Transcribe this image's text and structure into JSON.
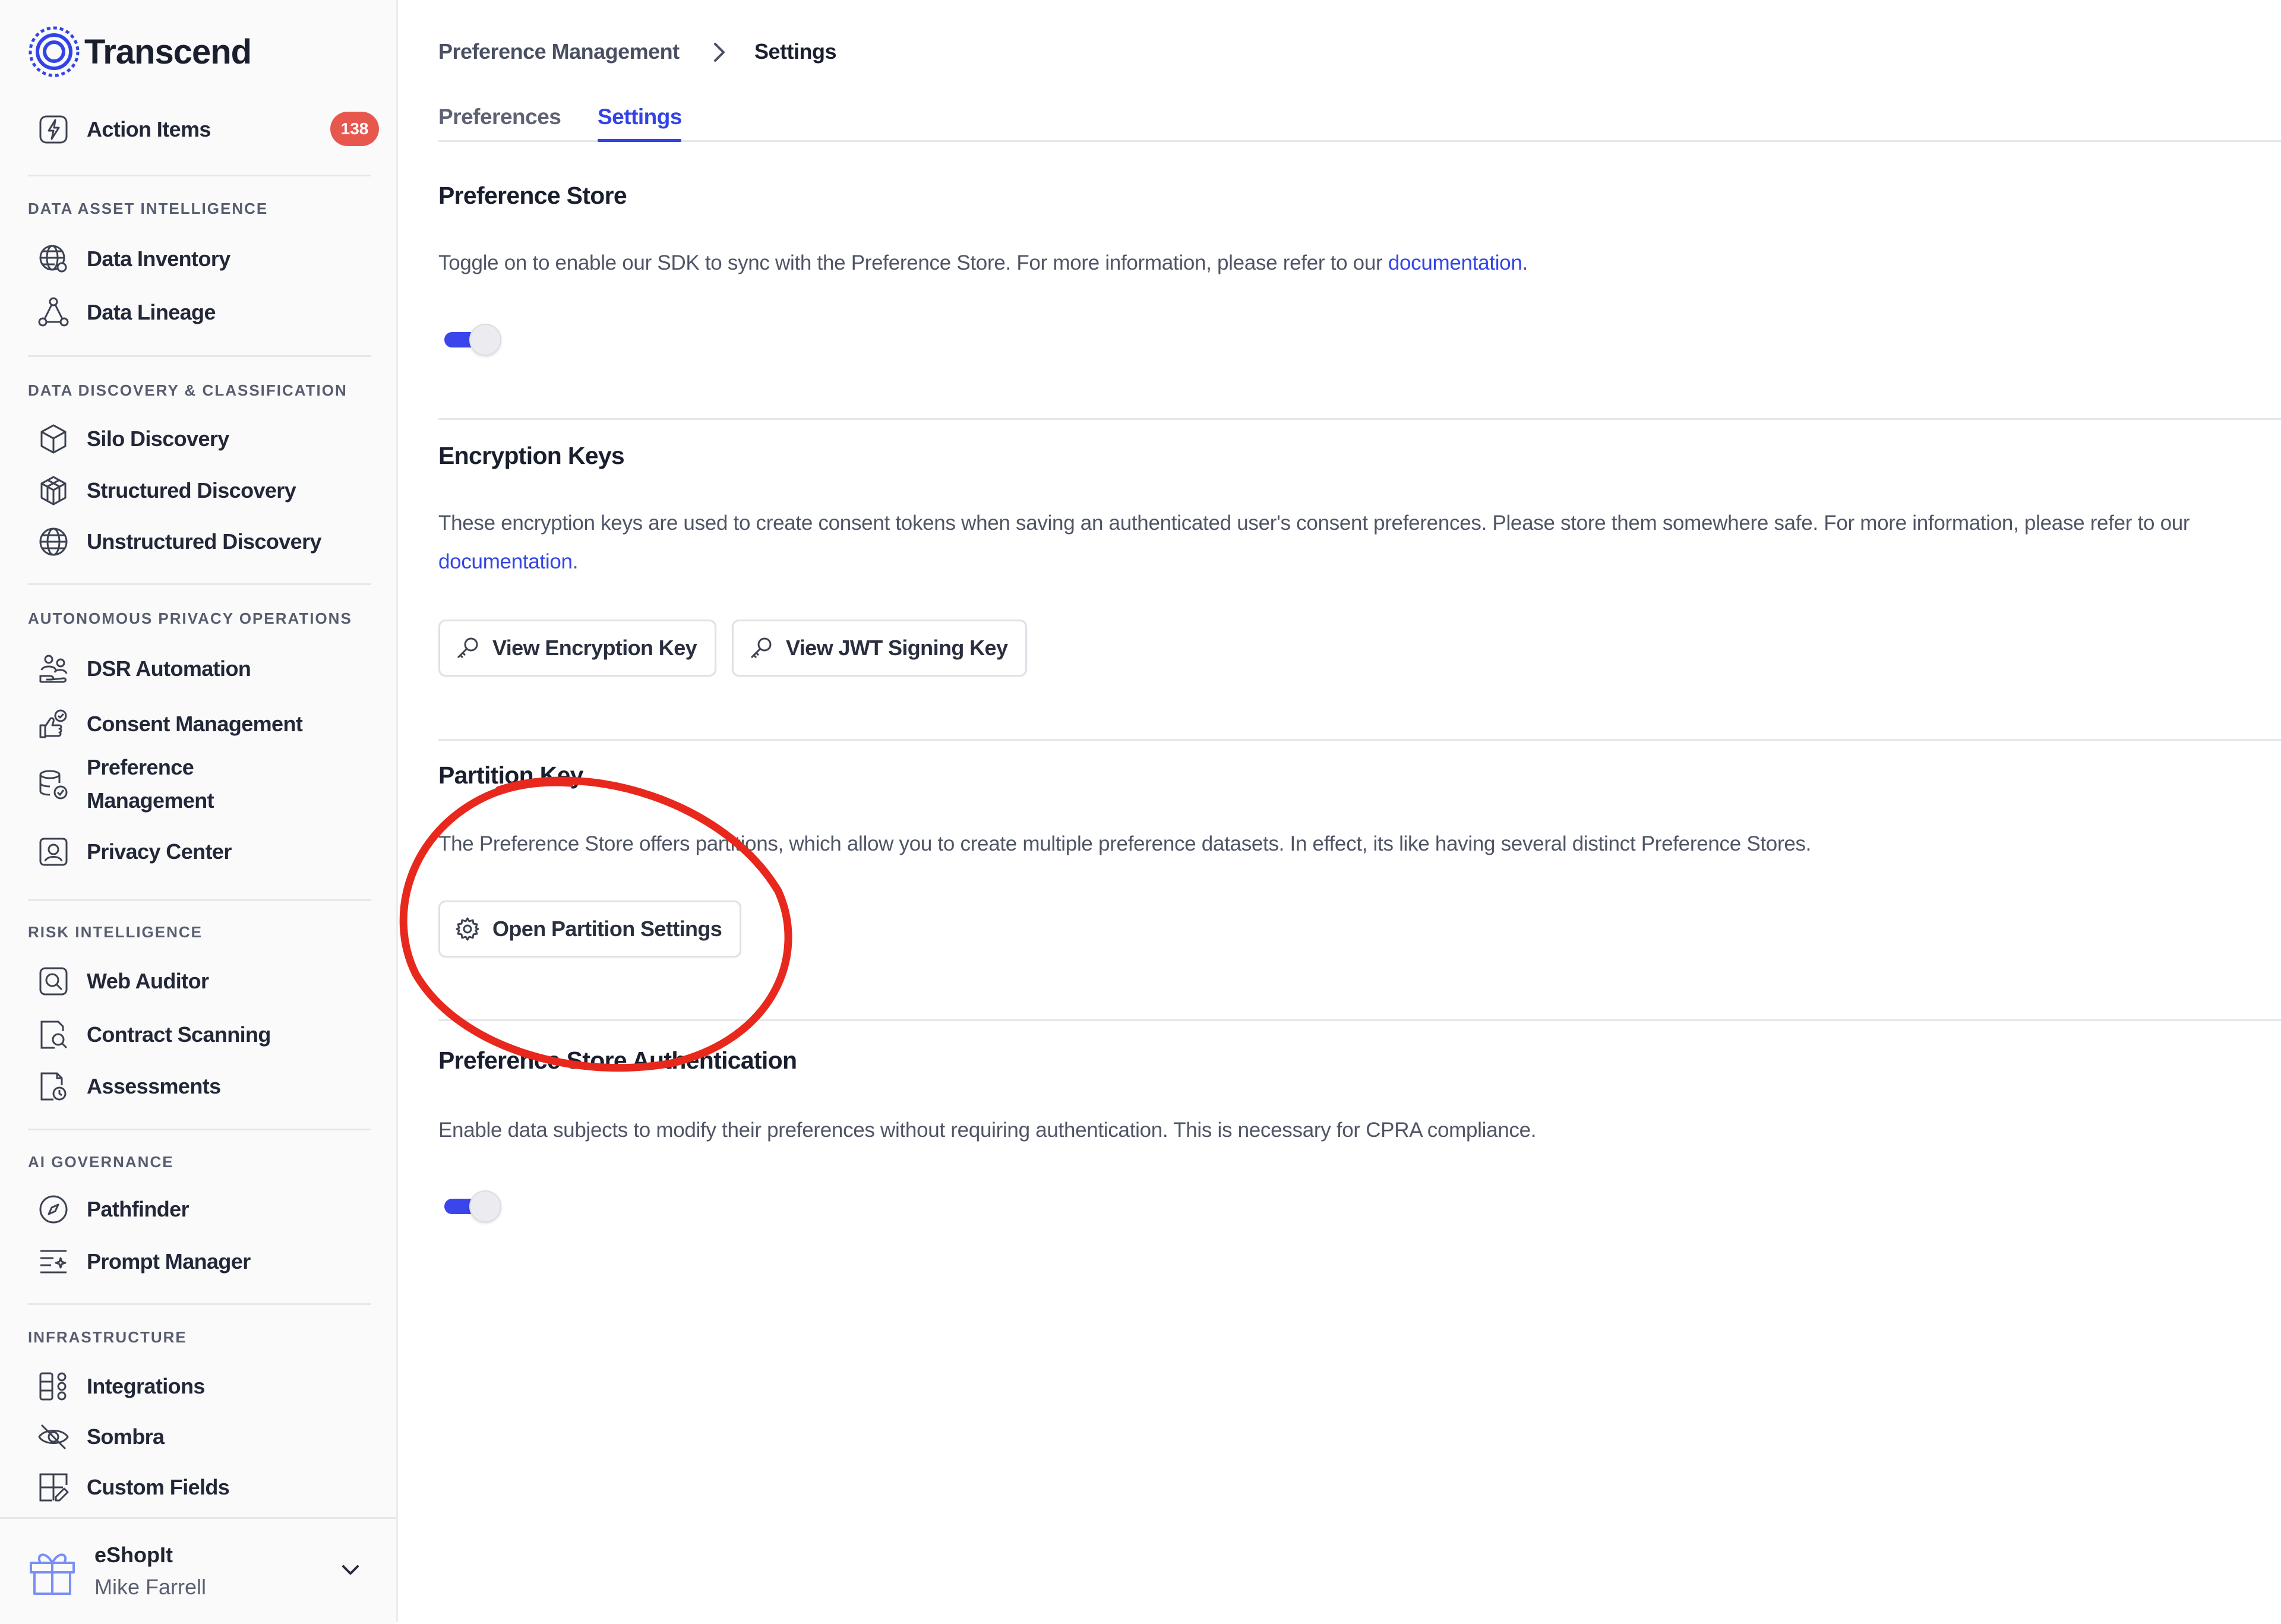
{
  "app": {
    "brand": "Transcend"
  },
  "sidebar": {
    "action_items": {
      "label": "Action Items",
      "badge": "138"
    },
    "sections": [
      {
        "title": "DATA ASSET INTELLIGENCE",
        "items": [
          {
            "label": "Data Inventory",
            "icon": "globe-icon"
          },
          {
            "label": "Data Lineage",
            "icon": "lineage-icon"
          }
        ]
      },
      {
        "title": "DATA DISCOVERY & CLASSIFICATION",
        "items": [
          {
            "label": "Silo Discovery",
            "icon": "cube-icon"
          },
          {
            "label": "Structured Discovery",
            "icon": "structured-cube-icon"
          },
          {
            "label": "Unstructured Discovery",
            "icon": "globe-grid-icon"
          }
        ]
      },
      {
        "title": "AUTONOMOUS PRIVACY OPERATIONS",
        "items": [
          {
            "label": "DSR Automation",
            "icon": "users-hand-icon"
          },
          {
            "label": "Consent Management",
            "icon": "thumbs-up-icon"
          },
          {
            "label": "Preference Management",
            "icon": "database-check-icon"
          },
          {
            "label": "Privacy Center",
            "icon": "portrait-icon"
          }
        ]
      },
      {
        "title": "RISK INTELLIGENCE",
        "items": [
          {
            "label": "Web Auditor",
            "icon": "scan-search-icon"
          },
          {
            "label": "Contract Scanning",
            "icon": "document-search-icon"
          },
          {
            "label": "Assessments",
            "icon": "document-clock-icon"
          }
        ]
      },
      {
        "title": "AI GOVERNANCE",
        "items": [
          {
            "label": "Pathfinder",
            "icon": "compass-icon"
          },
          {
            "label": "Prompt Manager",
            "icon": "text-sparkle-icon"
          }
        ]
      },
      {
        "title": "INFRASTRUCTURE",
        "items": [
          {
            "label": "Integrations",
            "icon": "integrations-icon"
          },
          {
            "label": "Sombra",
            "icon": "eye-off-icon"
          },
          {
            "label": "Custom Fields",
            "icon": "grid-edit-icon"
          }
        ]
      }
    ],
    "footer": {
      "org": "eShopIt",
      "user": "Mike Farrell",
      "icon": "gift-icon"
    }
  },
  "breadcrumb": {
    "parent": "Preference Management",
    "current": "Settings"
  },
  "tabs": [
    {
      "label": "Preferences"
    },
    {
      "label": "Settings",
      "active": true
    }
  ],
  "preference_store": {
    "title": "Preference Store",
    "desc": "Toggle on to enable our SDK to sync with the Preference Store. For more information, please refer to our",
    "link": "documentation",
    "toggle_on": true
  },
  "encryption_keys": {
    "title": "Encryption Keys",
    "desc": "These encryption keys are used to create consent tokens when saving an authenticated user's consent preferences. Please store them somewhere safe. For more information, please refer to our",
    "link": "documentation",
    "buttons": [
      "View Encryption Key",
      "View JWT Signing Key"
    ]
  },
  "partition_key": {
    "title": "Partition Key",
    "desc": "The Preference Store offers partitions, which allow you to create multiple preference datasets. In effect, its like having several distinct Preference Stores.",
    "button": "Open Partition Settings"
  },
  "store_auth": {
    "title": "Preference Store Authentication",
    "desc": "Enable data subjects to modify their preferences without requiring authentication. This is necessary for CPRA compliance.",
    "toggle_on": true
  },
  "colors": {
    "accent": "#3244e6",
    "badge": "#e8574d",
    "annotation": "#e8281c"
  }
}
